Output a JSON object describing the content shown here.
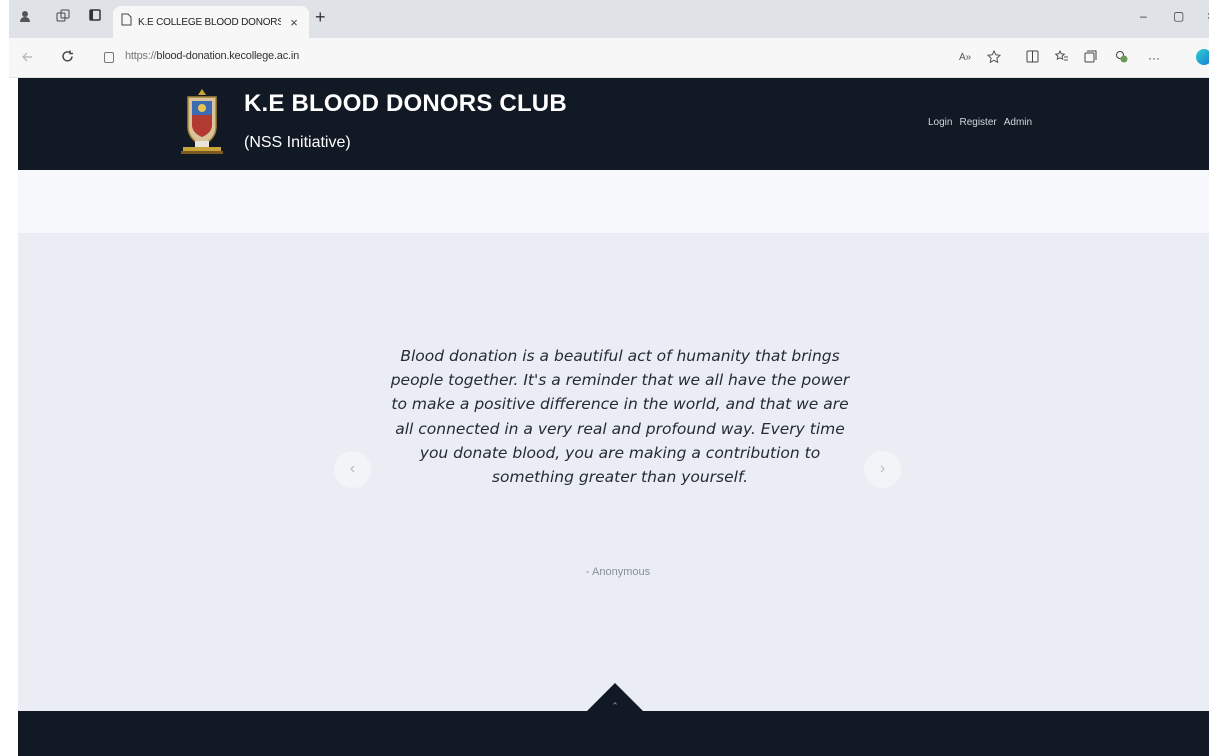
{
  "browser": {
    "tab_title": "K.E COLLEGE BLOOD DONORS CL",
    "tab_close": "×",
    "new_tab": "+",
    "url_protocol": "https://",
    "url_host": "blood-donation.kecollege.ac.in",
    "read_aloud": "A»",
    "more": "···",
    "minimize": "–",
    "restore": "▢",
    "close": "×"
  },
  "site": {
    "title": "K.E BLOOD DONORS CLUB",
    "subtitle": "(NSS Initiative)",
    "nav": [
      "Login",
      "Register",
      "Admin"
    ]
  },
  "testimonial": {
    "quote": "Blood donation is a beautiful act of humanity that brings people together. It's a reminder that we all have the power to make a positive difference in the world, and that we are all connected in a very real and profound way. Every time you donate blood, you are making a contribution to something greater than yourself.",
    "author": "- Anonymous",
    "prev_glyph": "‹",
    "next_glyph": "›"
  },
  "footer": {
    "to_top_glyph": "⌃"
  },
  "colors": {
    "header_bg": "#111a24",
    "hero_bg": "#eaeef4",
    "strip_bg": "#f6f8fb"
  }
}
